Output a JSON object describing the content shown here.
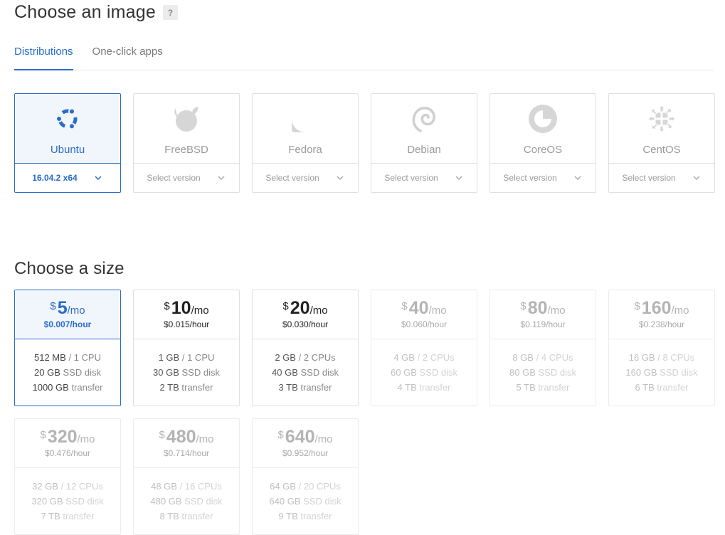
{
  "image_section": {
    "title": "Choose an image",
    "help": "?",
    "tabs": [
      {
        "label": "Distributions",
        "active": true
      },
      {
        "label": "One-click apps",
        "active": false
      }
    ],
    "distributions": [
      {
        "name": "Ubuntu",
        "icon": "ubuntu-icon",
        "version": "16.04.2 x64",
        "selected": true
      },
      {
        "name": "FreeBSD",
        "icon": "freebsd-icon",
        "version": "Select version",
        "selected": false
      },
      {
        "name": "Fedora",
        "icon": "fedora-icon",
        "version": "Select version",
        "selected": false
      },
      {
        "name": "Debian",
        "icon": "debian-icon",
        "version": "Select version",
        "selected": false
      },
      {
        "name": "CoreOS",
        "icon": "coreos-icon",
        "version": "Select version",
        "selected": false
      },
      {
        "name": "CentOS",
        "icon": "centos-icon",
        "version": "Select version",
        "selected": false
      }
    ]
  },
  "size_section": {
    "title": "Choose a size",
    "sizes": [
      {
        "currency": "$",
        "price": "5",
        "per": "/mo",
        "hourly": "$0.007/hour",
        "memory": "512 MB",
        "cpu": "1 CPU",
        "disk_amount": "20 GB",
        "disk_label": "SSD disk",
        "transfer_amount": "1000 GB",
        "transfer_label": "transfer",
        "state": "selected"
      },
      {
        "currency": "$",
        "price": "10",
        "per": "/mo",
        "hourly": "$0.015/hour",
        "memory": "1 GB",
        "cpu": "1 CPU",
        "disk_amount": "30 GB",
        "disk_label": "SSD disk",
        "transfer_amount": "2 TB",
        "transfer_label": "transfer",
        "state": "normal"
      },
      {
        "currency": "$",
        "price": "20",
        "per": "/mo",
        "hourly": "$0.030/hour",
        "memory": "2 GB",
        "cpu": "2 CPUs",
        "disk_amount": "40 GB",
        "disk_label": "SSD disk",
        "transfer_amount": "3 TB",
        "transfer_label": "transfer",
        "state": "normal"
      },
      {
        "currency": "$",
        "price": "40",
        "per": "/mo",
        "hourly": "$0.060/hour",
        "memory": "4 GB",
        "cpu": "2 CPUs",
        "disk_amount": "60 GB",
        "disk_label": "SSD disk",
        "transfer_amount": "4 TB",
        "transfer_label": "transfer",
        "state": "disabled"
      },
      {
        "currency": "$",
        "price": "80",
        "per": "/mo",
        "hourly": "$0.119/hour",
        "memory": "8 GB",
        "cpu": "4 CPUs",
        "disk_amount": "80 GB",
        "disk_label": "SSD disk",
        "transfer_amount": "5 TB",
        "transfer_label": "transfer",
        "state": "disabled"
      },
      {
        "currency": "$",
        "price": "160",
        "per": "/mo",
        "hourly": "$0.238/hour",
        "memory": "16 GB",
        "cpu": "8 CPUs",
        "disk_amount": "160 GB",
        "disk_label": "SSD disk",
        "transfer_amount": "6 TB",
        "transfer_label": "transfer",
        "state": "disabled"
      },
      {
        "currency": "$",
        "price": "320",
        "per": "/mo",
        "hourly": "$0.476/hour",
        "memory": "32 GB",
        "cpu": "12 CPUs",
        "disk_amount": "320 GB",
        "disk_label": "SSD disk",
        "transfer_amount": "7 TB",
        "transfer_label": "transfer",
        "state": "disabled"
      },
      {
        "currency": "$",
        "price": "480",
        "per": "/mo",
        "hourly": "$0.714/hour",
        "memory": "48 GB",
        "cpu": "16 CPUs",
        "disk_amount": "480 GB",
        "disk_label": "SSD disk",
        "transfer_amount": "8 TB",
        "transfer_label": "transfer",
        "state": "disabled"
      },
      {
        "currency": "$",
        "price": "640",
        "per": "/mo",
        "hourly": "$0.952/hour",
        "memory": "64 GB",
        "cpu": "20 CPUs",
        "disk_amount": "640 GB",
        "disk_label": "SSD disk",
        "transfer_amount": "9 TB",
        "transfer_label": "transfer",
        "state": "disabled"
      }
    ]
  },
  "colors": {
    "accent": "#2a6cc9",
    "selected_bg": "#f1f6fd",
    "border": "#e0e0e0"
  }
}
